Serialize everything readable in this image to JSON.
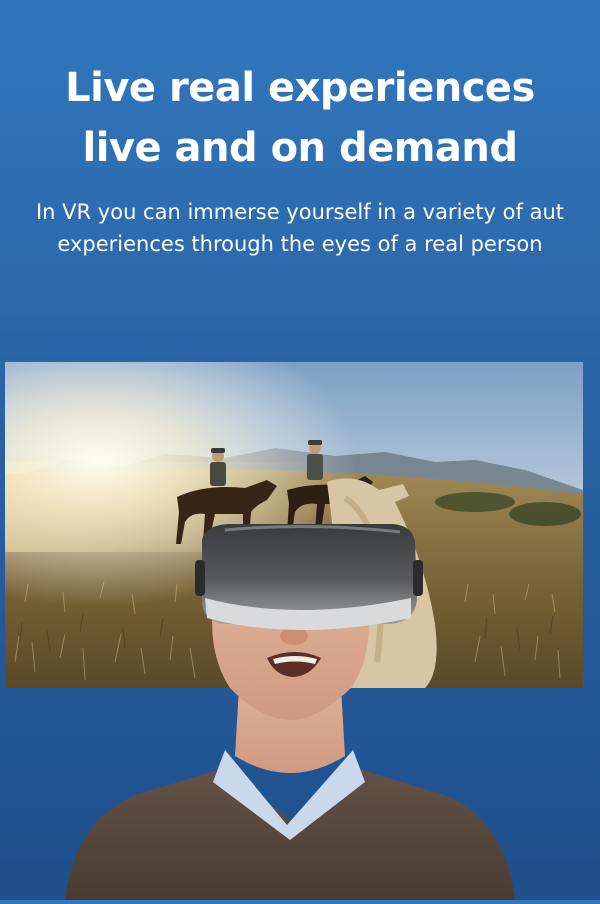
{
  "headline": {
    "line1": "Live real experiences",
    "line2": "live and on demand"
  },
  "subheadline": {
    "line1": "In VR you can immerse yourself in a variety of aut",
    "line2": "experiences through the eyes of a real person"
  },
  "colors": {
    "background_top": "#3277bd",
    "background_bottom": "#1e4f8b",
    "text": "#ffffff"
  },
  "images": {
    "scene": "riders-on-horseback-in-grassland-vr-view",
    "person": "smiling-man-wearing-vr-headset"
  }
}
